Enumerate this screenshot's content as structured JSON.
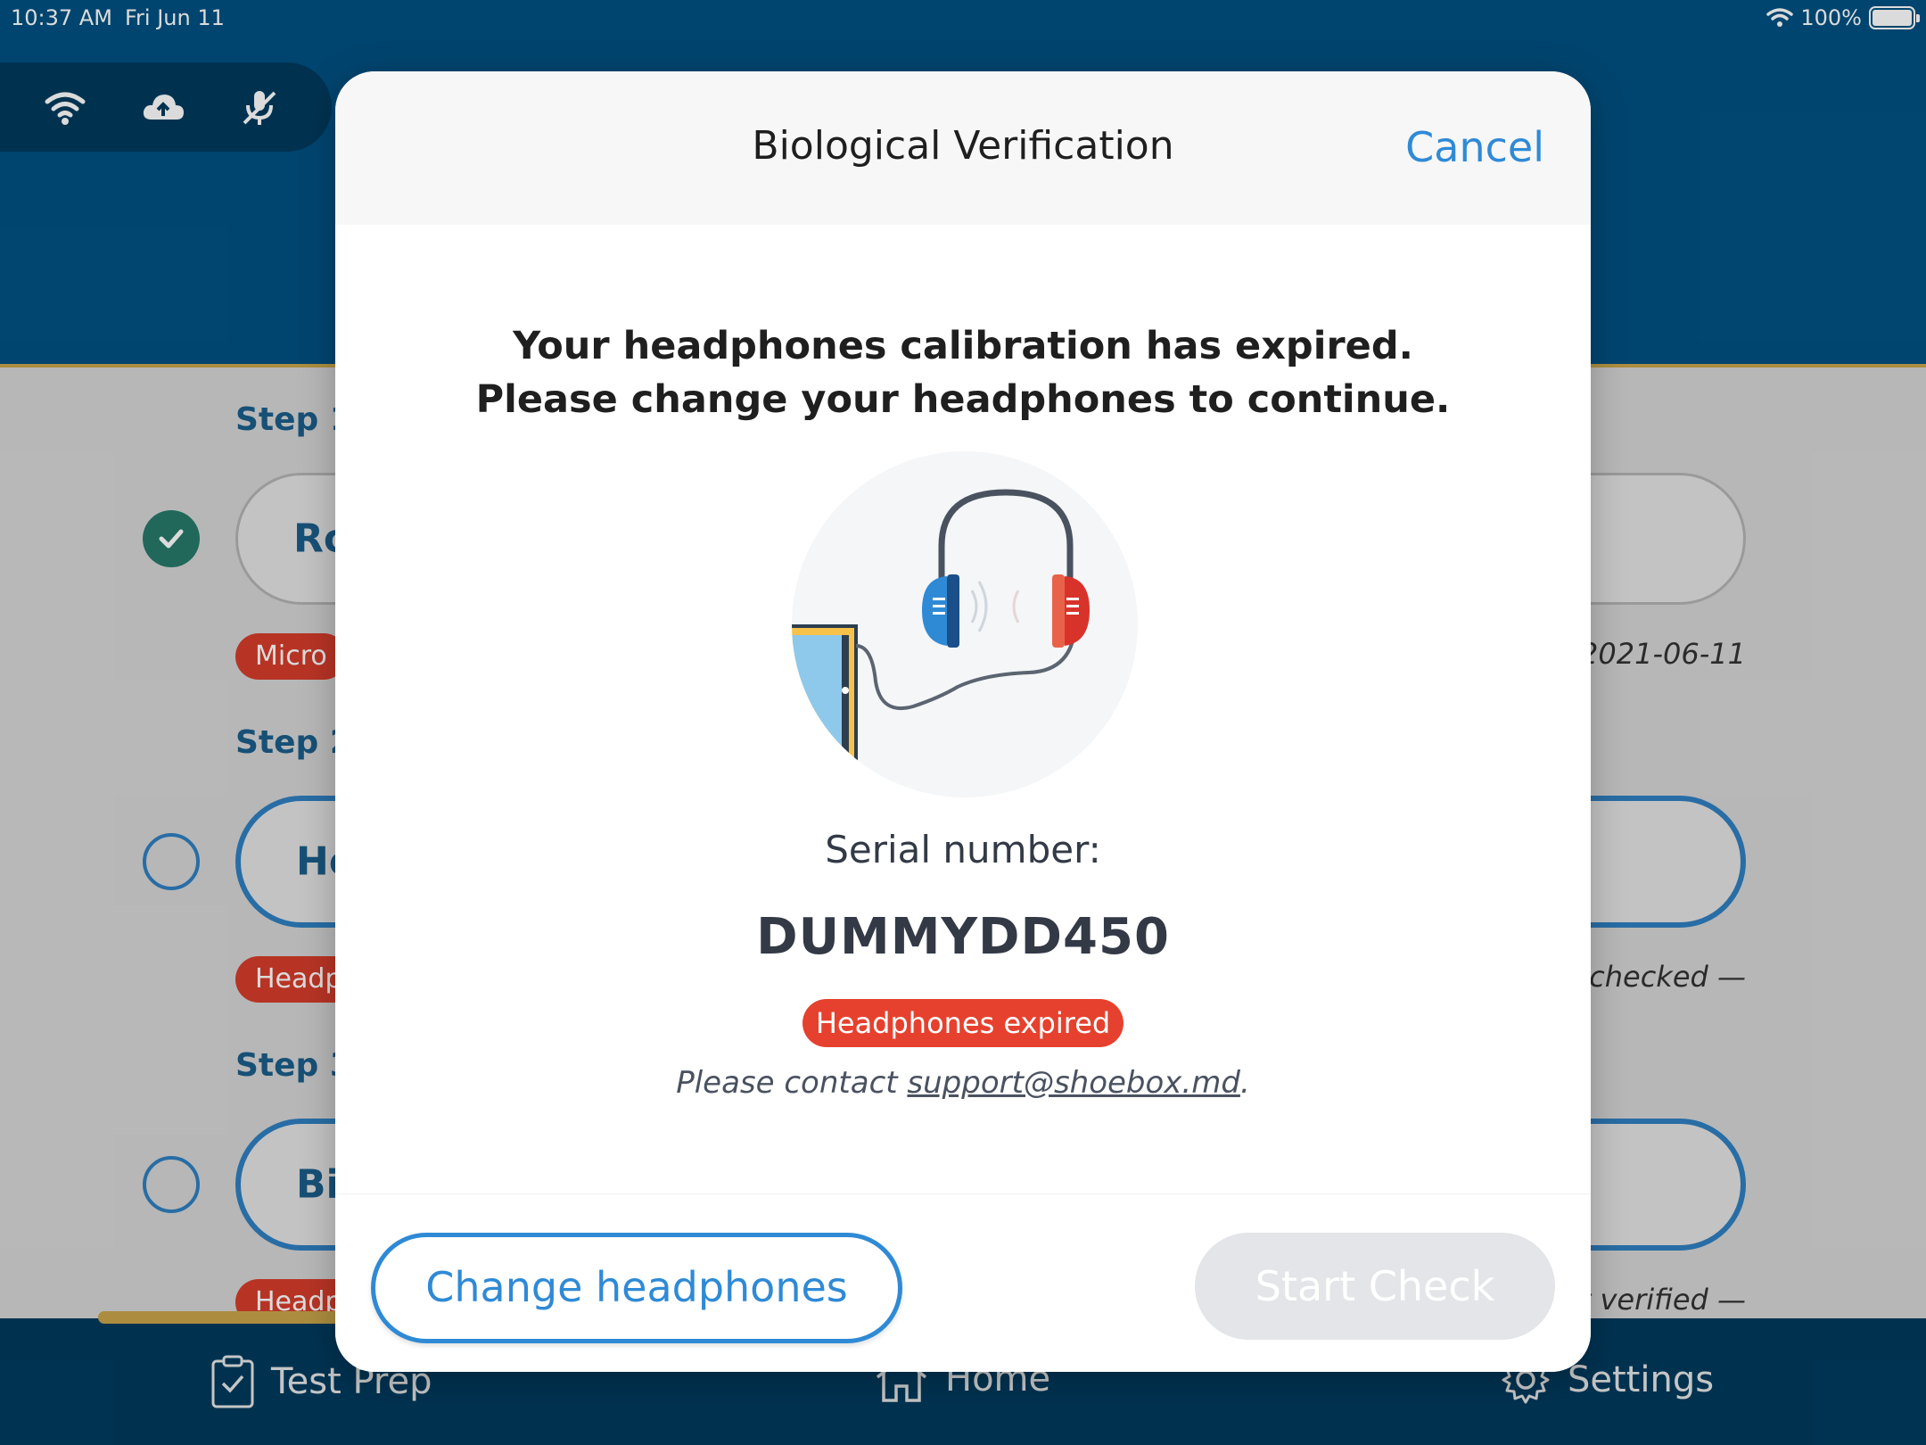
{
  "status_bar": {
    "time": "10:37 AM",
    "date": "Fri Jun 11",
    "battery": "100%"
  },
  "steps": [
    {
      "label": "Step 1",
      "pill_text": "Ro",
      "tag": "Micro",
      "note": "l 2021-06-11",
      "done": true
    },
    {
      "label": "Step 2",
      "pill_text": "He",
      "tag": "Headp",
      "note": "t checked  —",
      "done": false
    },
    {
      "label": "Step 3",
      "pill_text": "Bic",
      "tag": "Headp",
      "note": "st verified  —",
      "done": false
    }
  ],
  "nav": {
    "test_prep": "Test Prep",
    "home": "Home",
    "settings": "Settings"
  },
  "modal": {
    "title": "Biological Verification",
    "cancel": "Cancel",
    "message_line1": "Your headphones calibration has expired.",
    "message_line2": "Please change your headphones to continue.",
    "serial_label": "Serial number:",
    "serial_value": "DUMMYDD450",
    "badge": "Headphones expired",
    "contact_prefix": "Please contact ",
    "contact_email": "support@shoebox.md",
    "contact_suffix": ".",
    "change_button": "Change headphones",
    "start_button": "Start Check"
  },
  "colors": {
    "brand_blue": "#005182",
    "accent_blue": "#2f8ad6",
    "alert_red": "#e6412e",
    "gold": "#c9a54a"
  }
}
